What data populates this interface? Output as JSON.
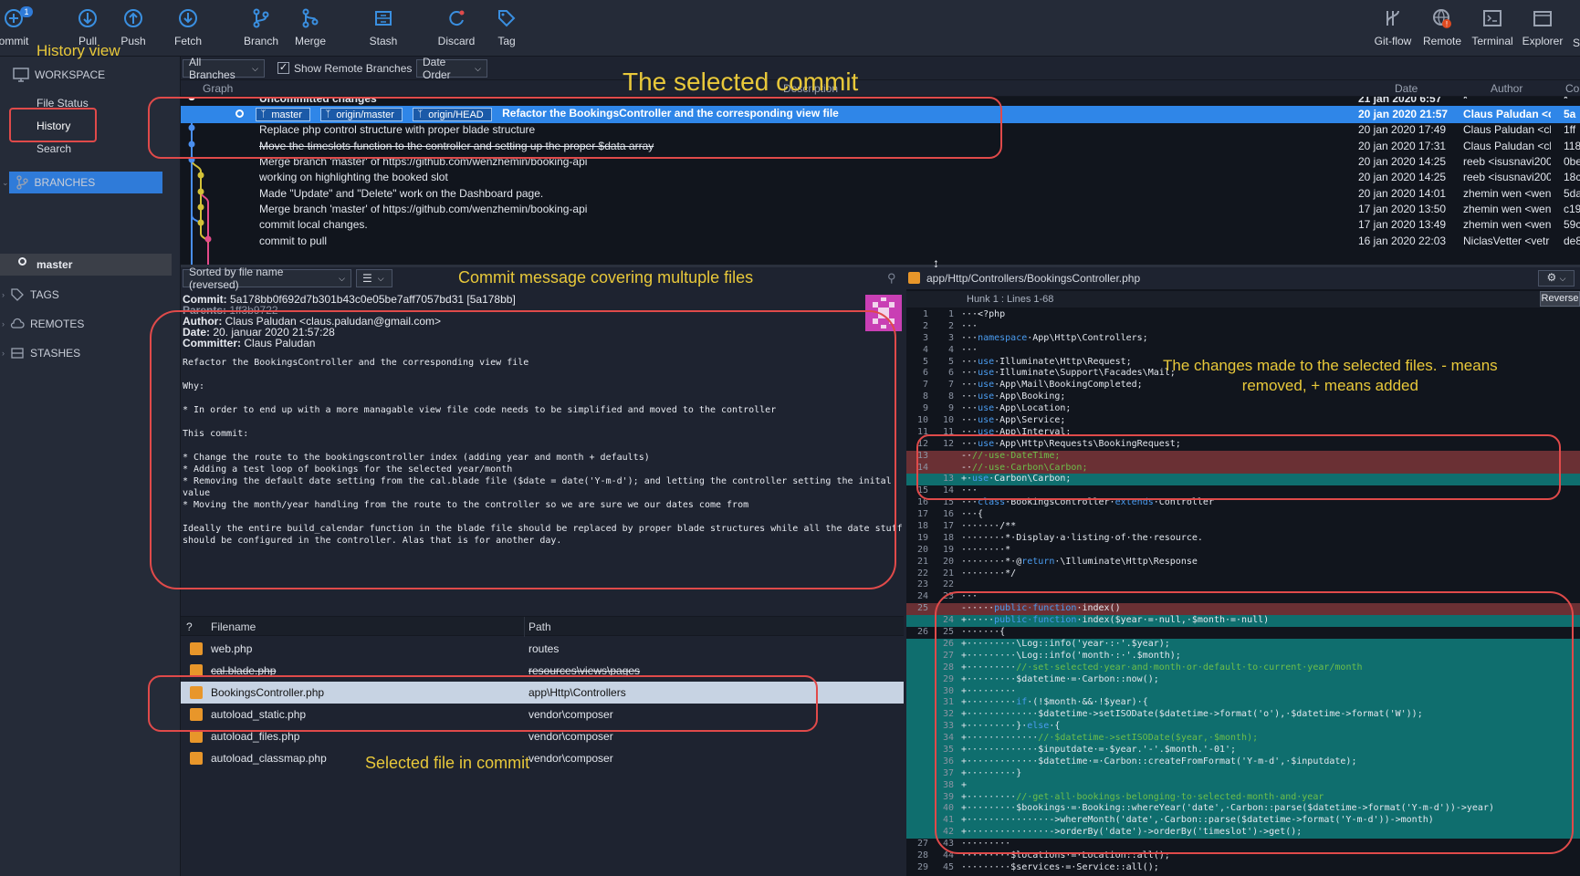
{
  "toolbar": {
    "commit": {
      "label": "ommit",
      "badge": "1"
    },
    "pull": "Pull",
    "push": "Push",
    "fetch": "Fetch",
    "branch": "Branch",
    "merge": "Merge",
    "stash": "Stash",
    "discard": "Discard",
    "tag": "Tag",
    "gitflow": "Git-flow",
    "remote": "Remote",
    "terminal": "Terminal",
    "explorer": "Explorer",
    "settings_partial": "S"
  },
  "sidebar": {
    "workspace": "WORKSPACE",
    "file_status": "File Status",
    "history": "History",
    "search": "Search",
    "branches": "BRANCHES",
    "master": "master",
    "tags": "TAGS",
    "remotes": "REMOTES",
    "stashes": "STASHES"
  },
  "filters": {
    "branches": "All Branches",
    "show_remote": "Show Remote Branches",
    "order": "Date Order"
  },
  "columns": {
    "graph": "Graph",
    "description": "Description",
    "date": "Date",
    "author": "Author",
    "commit": "Co"
  },
  "commits": [
    {
      "message": "Uncommitted changes",
      "date": "21 jan 2020 6:57",
      "author": "*",
      "hash": "*"
    },
    {
      "refs": [
        "master",
        "origin/master",
        "origin/HEAD"
      ],
      "message": "Refactor the BookingsController and the corresponding view file",
      "date": "20 jan 2020 21:57",
      "author": "Claus Paludan <cla",
      "hash": "5a"
    },
    {
      "message": "Replace php control structure with proper blade structure",
      "date": "20 jan 2020 17:49",
      "author": "Claus Paludan <cla",
      "hash": "1ff"
    },
    {
      "message": "Move the timeslots function to the controller and setting up the proper $data array",
      "date": "20 jan 2020 17:31",
      "author": "Claus Paludan <cla",
      "hash": "118"
    },
    {
      "message": "Merge branch 'master' of https://github.com/wenzhemin/booking-api",
      "date": "20 jan 2020 14:25",
      "author": "reeb <isusnavi2005",
      "hash": "0be"
    },
    {
      "message": "working on highlighting the booked slot",
      "date": "20 jan 2020 14:25",
      "author": "reeb <isusnavi2005",
      "hash": "18c"
    },
    {
      "message": "Made \"Update\" and \"Delete\" work on the Dashboard page.",
      "date": "20 jan 2020 14:01",
      "author": "zhemin wen <wen",
      "hash": "5da"
    },
    {
      "message": "Merge branch 'master' of https://github.com/wenzhemin/booking-api",
      "date": "17 jan 2020 13:50",
      "author": "zhemin wen <wen",
      "hash": "c19"
    },
    {
      "message": "commit local changes.",
      "date": "17 jan 2020 13:49",
      "author": "zhemin wen <wen",
      "hash": "59c"
    },
    {
      "message": "commit to pull",
      "date": "16 jan 2020 22:03",
      "author": "NiclasVetter <vetr",
      "hash": "de8"
    }
  ],
  "details": {
    "sort": "Sorted by file name (reversed)",
    "view_icon": "list-icon",
    "commit_label": "Commit:",
    "commit_value": "5a178bb0f692d7b301b43c0e05be7aff7057bd31 [5a178bb]",
    "parents_label": "Parents:",
    "parents_value": "1ff3b9722",
    "author_label": "Author:",
    "author_value": "Claus Paludan <claus.paludan@gmail.com>",
    "date_label": "Date:",
    "date_value": "20. januar 2020 21:57:28",
    "committer_label": "Committer:",
    "committer_value": "Claus Paludan",
    "body": "Refactor the BookingsController and the corresponding view file\n\nWhy:\n\n* In order to end up with a more managable view file code needs to be simplified and moved to the controller\n\nThis commit:\n\n* Change the route to the bookingscontroller index (adding year and month + defaults)\n* Adding a test loop of bookings for the selected year/month\n* Removing the default date setting from the cal.blade file ($date = date('Y-m-d'); and letting the controller setting the inital\nvalue\n* Moving the month/year handling from the route to the controller so we are sure we our dates come from\n\nIdeally the entire build_calendar function in the blade file should be replaced by proper blade structures while all the date stuff\nshould be configured in the controller. Alas that is for another day."
  },
  "files": {
    "header_q": "?",
    "header_filename": "Filename",
    "header_path": "Path",
    "rows": [
      {
        "name": "web.php",
        "path": "routes"
      },
      {
        "name": "cal.blade.php",
        "path": "resources\\views\\pages"
      },
      {
        "name": "BookingsController.php",
        "path": "app\\Http\\Controllers"
      },
      {
        "name": "autoload_static.php",
        "path": "vendor\\composer"
      },
      {
        "name": "autoload_files.php",
        "path": "vendor\\composer"
      },
      {
        "name": "autoload_classmap.php",
        "path": "vendor\\composer"
      }
    ]
  },
  "diff": {
    "file_path": "app/Http/Controllers/BookingsController.php",
    "hunk": "Hunk 1 : Lines 1-68",
    "reverse": "Reverse"
  },
  "annotations": {
    "history_view": "History view",
    "selected_commit": "The selected commit",
    "commit_message": "Commit message covering multuple files",
    "changes_line1": "The changes made to the selected files. - means",
    "changes_line2": "removed, + means added",
    "selected_file": "Selected file in commit"
  },
  "colors": {
    "selection": "#2f86e8",
    "annotation": "#e8c83a",
    "highlight_box": "#e04a4a",
    "diff_removed": "#6a3034",
    "diff_added": "#0f6e6e"
  }
}
